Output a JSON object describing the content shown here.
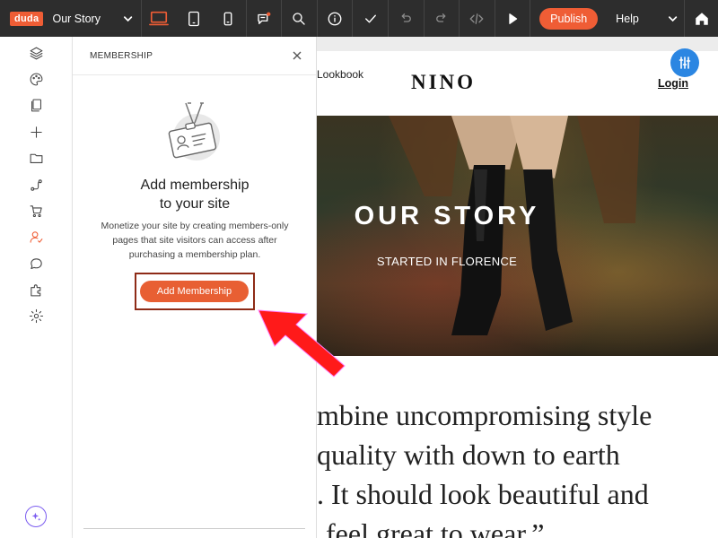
{
  "toolbar": {
    "logo": "duda",
    "site_name": "Our Story",
    "publish_label": "Publish",
    "help_label": "Help",
    "icons": [
      "desktop-icon",
      "tablet-icon",
      "mobile-icon",
      "comments-icon",
      "search-icon",
      "info-icon",
      "check-icon",
      "undo-icon",
      "redo-icon",
      "code-icon",
      "play-icon",
      "home-icon"
    ]
  },
  "sidebar": {
    "items": [
      {
        "icon": "layers-icon"
      },
      {
        "icon": "palette-icon"
      },
      {
        "icon": "pages-icon"
      },
      {
        "icon": "add-icon"
      },
      {
        "icon": "folder-icon"
      },
      {
        "icon": "connections-icon"
      },
      {
        "icon": "cart-icon"
      },
      {
        "icon": "membership-icon",
        "active": true
      },
      {
        "icon": "chat-icon"
      },
      {
        "icon": "apps-icon"
      },
      {
        "icon": "settings-icon"
      }
    ],
    "ai_icon": "sparkle-icon"
  },
  "panel": {
    "title": "MEMBERSHIP",
    "heading_line1": "Add membership",
    "heading_line2": "to your site",
    "description": "Monetize your site by creating members-only pages that site visitors can access after purchasing a membership plan.",
    "button_label": "Add Membership"
  },
  "preview": {
    "nav_link": "Lookbook",
    "brand": "NINO",
    "login": "Login",
    "hero_title": "OUR STORY",
    "hero_subtitle": "STARTED IN FLORENCE",
    "quote_lines": [
      "mbine uncompromising style",
      "quality with down to earth",
      ". It should look beautiful and",
      "feel great to wear.”"
    ]
  },
  "colors": {
    "accent": "#ef5d35",
    "toolbar_bg": "#2d2d2d",
    "fab_blue": "#2b86e2",
    "annotation_red": "#ff1a1a",
    "annotation_box": "#8e2b17"
  }
}
